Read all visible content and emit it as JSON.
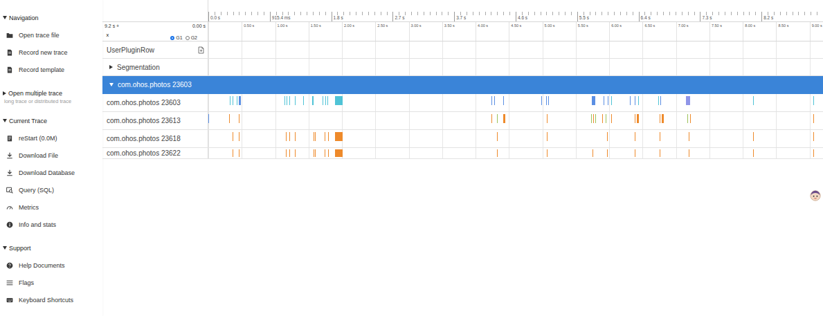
{
  "sidebar": {
    "groups": [
      {
        "title": "Navigation",
        "expanded": true,
        "items": [
          "Open trace file",
          "Record new trace",
          "Record template"
        ]
      },
      {
        "title": "Open multiple trace",
        "expanded": false,
        "subtitle": "long trace or distributed trace",
        "items": []
      },
      {
        "title": "Current Trace",
        "expanded": true,
        "items": [
          "reStart (0.0M)",
          "Download File",
          "Download Database",
          "Query (SQL)",
          "Metrics",
          "Info and stats"
        ]
      },
      {
        "title": "Support",
        "expanded": true,
        "items": [
          "Help Documents",
          "Flags",
          "Keyboard Shortcuts"
        ]
      }
    ]
  },
  "timeline": {
    "span_s": 9.2,
    "range_start": "9.2 s +",
    "range_end": "0.00 s",
    "toggle_glyphs": [
      "⌄",
      "⌃"
    ],
    "overview_ticks": [
      "0.0 s",
      "915.4 ms",
      "1.8 s",
      "2.7 s",
      "3.7 s",
      "4.6 s",
      "5.5 s",
      "6.4 s",
      "7.3 s",
      "8.2 s"
    ],
    "ticks": [
      {
        "label": "0.50 s",
        "t": 0.5
      },
      {
        "label": "1.00 s",
        "t": 1.0
      },
      {
        "label": "1.50 s",
        "t": 1.5
      },
      {
        "label": "2.00 s",
        "t": 2.0
      },
      {
        "label": "2.50 s",
        "t": 2.5
      },
      {
        "label": "3.00 s",
        "t": 3.0
      },
      {
        "label": "3.50 s",
        "t": 3.5
      },
      {
        "label": "4.00 s",
        "t": 4.0
      },
      {
        "label": "4.50 s",
        "t": 4.5
      },
      {
        "label": "5.00 s",
        "t": 5.0
      },
      {
        "label": "5.50 s",
        "t": 5.5
      },
      {
        "label": "6.00 s",
        "t": 6.0
      },
      {
        "label": "6.50 s",
        "t": 6.5
      },
      {
        "label": "7.00 s",
        "t": 7.0
      },
      {
        "label": "7.50 s",
        "t": 7.5
      },
      {
        "label": "8.00 s",
        "t": 8.0
      },
      {
        "label": "8.50 s",
        "t": 8.5
      },
      {
        "label": "9.00 s",
        "t": 9.0
      }
    ],
    "groups": [
      {
        "label": "G1",
        "selected": true
      },
      {
        "label": "G2",
        "selected": false
      }
    ]
  },
  "rows": [
    {
      "label": "UserPluginRow",
      "kind": "plugin"
    },
    {
      "label": "Segmentation",
      "kind": "folder",
      "expanded": false
    },
    {
      "label": "com.ohos.photos 23603",
      "kind": "process",
      "expanded": true,
      "selected": true
    },
    {
      "label": "com.ohos.photos 23603",
      "kind": "thread",
      "slices": [
        {
          "t": 0.32,
          "d": 0.01,
          "color": "#4fc3d6"
        },
        {
          "t": 0.36,
          "d": 0.01,
          "color": "#4fc3d6"
        },
        {
          "t": 0.42,
          "d": 0.01,
          "color": "#4fc3d6"
        },
        {
          "t": 0.46,
          "d": 0.03,
          "color": "#5b8fe3"
        },
        {
          "t": 1.14,
          "d": 0.01,
          "color": "#4fc3d6"
        },
        {
          "t": 1.17,
          "d": 0.01,
          "color": "#4fc3d6"
        },
        {
          "t": 1.21,
          "d": 0.01,
          "color": "#4fc3d6"
        },
        {
          "t": 1.3,
          "d": 0.01,
          "color": "#4fc3d6"
        },
        {
          "t": 1.42,
          "d": 0.01,
          "color": "#4fc3d6"
        },
        {
          "t": 1.55,
          "d": 0.02,
          "color": "#4fc3d6"
        },
        {
          "t": 1.71,
          "d": 0.01,
          "color": "#4fc3d6"
        },
        {
          "t": 1.75,
          "d": 0.01,
          "color": "#4fc3d6"
        },
        {
          "t": 1.78,
          "d": 0.01,
          "color": "#4fc3d6"
        },
        {
          "t": 1.9,
          "d": 0.11,
          "color": "#4fc3d6"
        },
        {
          "t": 4.24,
          "d": 0.01,
          "color": "#5b8fe3"
        },
        {
          "t": 4.28,
          "d": 0.01,
          "color": "#5b8fe3"
        },
        {
          "t": 4.41,
          "d": 0.01,
          "color": "#5b8fe3"
        },
        {
          "t": 4.98,
          "d": 0.01,
          "color": "#5b8fe3"
        },
        {
          "t": 5.06,
          "d": 0.01,
          "color": "#5b8fe3"
        },
        {
          "t": 5.09,
          "d": 0.01,
          "color": "#5b8fe3"
        },
        {
          "t": 5.74,
          "d": 0.05,
          "color": "#5b8fe3"
        },
        {
          "t": 5.92,
          "d": 0.01,
          "color": "#5b8fe3"
        },
        {
          "t": 5.98,
          "d": 0.01,
          "color": "#5b8fe3"
        },
        {
          "t": 6.03,
          "d": 0.01,
          "color": "#4fc3d6"
        },
        {
          "t": 6.31,
          "d": 0.01,
          "color": "#5b8fe3"
        },
        {
          "t": 6.38,
          "d": 0.01,
          "color": "#5b8fe3"
        },
        {
          "t": 6.43,
          "d": 0.01,
          "color": "#4fc3d6"
        },
        {
          "t": 6.73,
          "d": 0.01,
          "color": "#4fc3d6"
        },
        {
          "t": 6.77,
          "d": 0.01,
          "color": "#5b8fe3"
        },
        {
          "t": 7.15,
          "d": 0.06,
          "color": "#8f95e8"
        },
        {
          "t": 8.15,
          "d": 0.01,
          "color": "#4fc3d6"
        },
        {
          "t": 9.05,
          "d": 0.01,
          "color": "#4fc3d6"
        }
      ]
    },
    {
      "label": "com.ohos.photos 23613",
      "kind": "thread",
      "slices": [
        {
          "t": 0.0,
          "d": 0.01,
          "color": "#5b8fe3"
        },
        {
          "t": 0.31,
          "d": 0.01,
          "color": "#ee8a2b"
        },
        {
          "t": 0.46,
          "d": 0.01,
          "color": "#ee8a2b"
        },
        {
          "t": 4.24,
          "d": 0.01,
          "color": "#ee8a2b"
        },
        {
          "t": 4.32,
          "d": 0.01,
          "color": "#9cc35a"
        },
        {
          "t": 4.41,
          "d": 0.03,
          "color": "#ee8a2b"
        },
        {
          "t": 5.07,
          "d": 0.01,
          "color": "#ee8a2b"
        },
        {
          "t": 5.73,
          "d": 0.01,
          "color": "#9cc35a"
        },
        {
          "t": 5.76,
          "d": 0.01,
          "color": "#ee8a2b"
        },
        {
          "t": 5.79,
          "d": 0.01,
          "color": "#9cc35a"
        },
        {
          "t": 5.9,
          "d": 0.01,
          "color": "#ee8a2b"
        },
        {
          "t": 5.95,
          "d": 0.01,
          "color": "#9cc35a"
        },
        {
          "t": 6.03,
          "d": 0.01,
          "color": "#ee8a2b"
        },
        {
          "t": 6.38,
          "d": 0.01,
          "color": "#ee8a2b"
        },
        {
          "t": 6.41,
          "d": 0.03,
          "color": "#ee8a2b"
        },
        {
          "t": 6.76,
          "d": 0.01,
          "color": "#ee8a2b"
        },
        {
          "t": 6.79,
          "d": 0.03,
          "color": "#ee8a2b"
        },
        {
          "t": 7.17,
          "d": 0.01,
          "color": "#9cc35a"
        },
        {
          "t": 7.21,
          "d": 0.01,
          "color": "#ee8a2b"
        },
        {
          "t": 9.05,
          "d": 0.01,
          "color": "#ee8a2b"
        }
      ]
    },
    {
      "label": "com.ohos.photos 23618",
      "kind": "thread",
      "slices": [
        {
          "t": 0.36,
          "d": 0.01,
          "color": "#ee8a2b"
        },
        {
          "t": 0.46,
          "d": 0.01,
          "color": "#ee8a2b"
        },
        {
          "t": 1.16,
          "d": 0.01,
          "color": "#ee8a2b"
        },
        {
          "t": 1.21,
          "d": 0.01,
          "color": "#ee8a2b"
        },
        {
          "t": 1.3,
          "d": 0.01,
          "color": "#ee8a2b"
        },
        {
          "t": 1.57,
          "d": 0.01,
          "color": "#ee8a2b"
        },
        {
          "t": 1.6,
          "d": 0.01,
          "color": "#ee8a2b"
        },
        {
          "t": 1.74,
          "d": 0.01,
          "color": "#ee8a2b"
        },
        {
          "t": 1.79,
          "d": 0.01,
          "color": "#ee8a2b"
        },
        {
          "t": 1.9,
          "d": 0.11,
          "color": "#ee8a2b"
        },
        {
          "t": 4.32,
          "d": 0.01,
          "color": "#ee8a2b"
        },
        {
          "t": 5.07,
          "d": 0.01,
          "color": "#ee8a2b"
        },
        {
          "t": 5.97,
          "d": 0.01,
          "color": "#ee8a2b"
        },
        {
          "t": 6.38,
          "d": 0.01,
          "color": "#ee8a2b"
        },
        {
          "t": 6.76,
          "d": 0.01,
          "color": "#ee8a2b"
        },
        {
          "t": 7.19,
          "d": 0.01,
          "color": "#ee8a2b"
        },
        {
          "t": 8.15,
          "d": 0.01,
          "color": "#ee8a2b"
        },
        {
          "t": 9.05,
          "d": 0.01,
          "color": "#ee8a2b"
        }
      ]
    },
    {
      "label": "com.ohos.photos 23622",
      "kind": "thread",
      "slices": [
        {
          "t": 0.36,
          "d": 0.01,
          "color": "#ee8a2b"
        },
        {
          "t": 0.46,
          "d": 0.01,
          "color": "#ee8a2b"
        },
        {
          "t": 1.16,
          "d": 0.01,
          "color": "#ee8a2b"
        },
        {
          "t": 1.21,
          "d": 0.01,
          "color": "#ee8a2b"
        },
        {
          "t": 1.3,
          "d": 0.01,
          "color": "#ee8a2b"
        },
        {
          "t": 1.57,
          "d": 0.01,
          "color": "#ee8a2b"
        },
        {
          "t": 1.6,
          "d": 0.01,
          "color": "#ee8a2b"
        },
        {
          "t": 1.74,
          "d": 0.01,
          "color": "#ee8a2b"
        },
        {
          "t": 1.79,
          "d": 0.01,
          "color": "#ee8a2b"
        },
        {
          "t": 1.9,
          "d": 0.11,
          "color": "#ee8a2b"
        },
        {
          "t": 4.32,
          "d": 0.01,
          "color": "#ee8a2b"
        },
        {
          "t": 5.07,
          "d": 0.01,
          "color": "#ee8a2b"
        },
        {
          "t": 5.75,
          "d": 0.01,
          "color": "#ee8a2b"
        },
        {
          "t": 5.97,
          "d": 0.01,
          "color": "#ee8a2b"
        },
        {
          "t": 6.38,
          "d": 0.01,
          "color": "#ee8a2b"
        },
        {
          "t": 6.76,
          "d": 0.01,
          "color": "#ee8a2b"
        },
        {
          "t": 7.19,
          "d": 0.01,
          "color": "#ee8a2b"
        },
        {
          "t": 8.15,
          "d": 0.01,
          "color": "#ee8a2b"
        },
        {
          "t": 9.05,
          "d": 0.01,
          "color": "#ee8a2b"
        }
      ]
    }
  ]
}
